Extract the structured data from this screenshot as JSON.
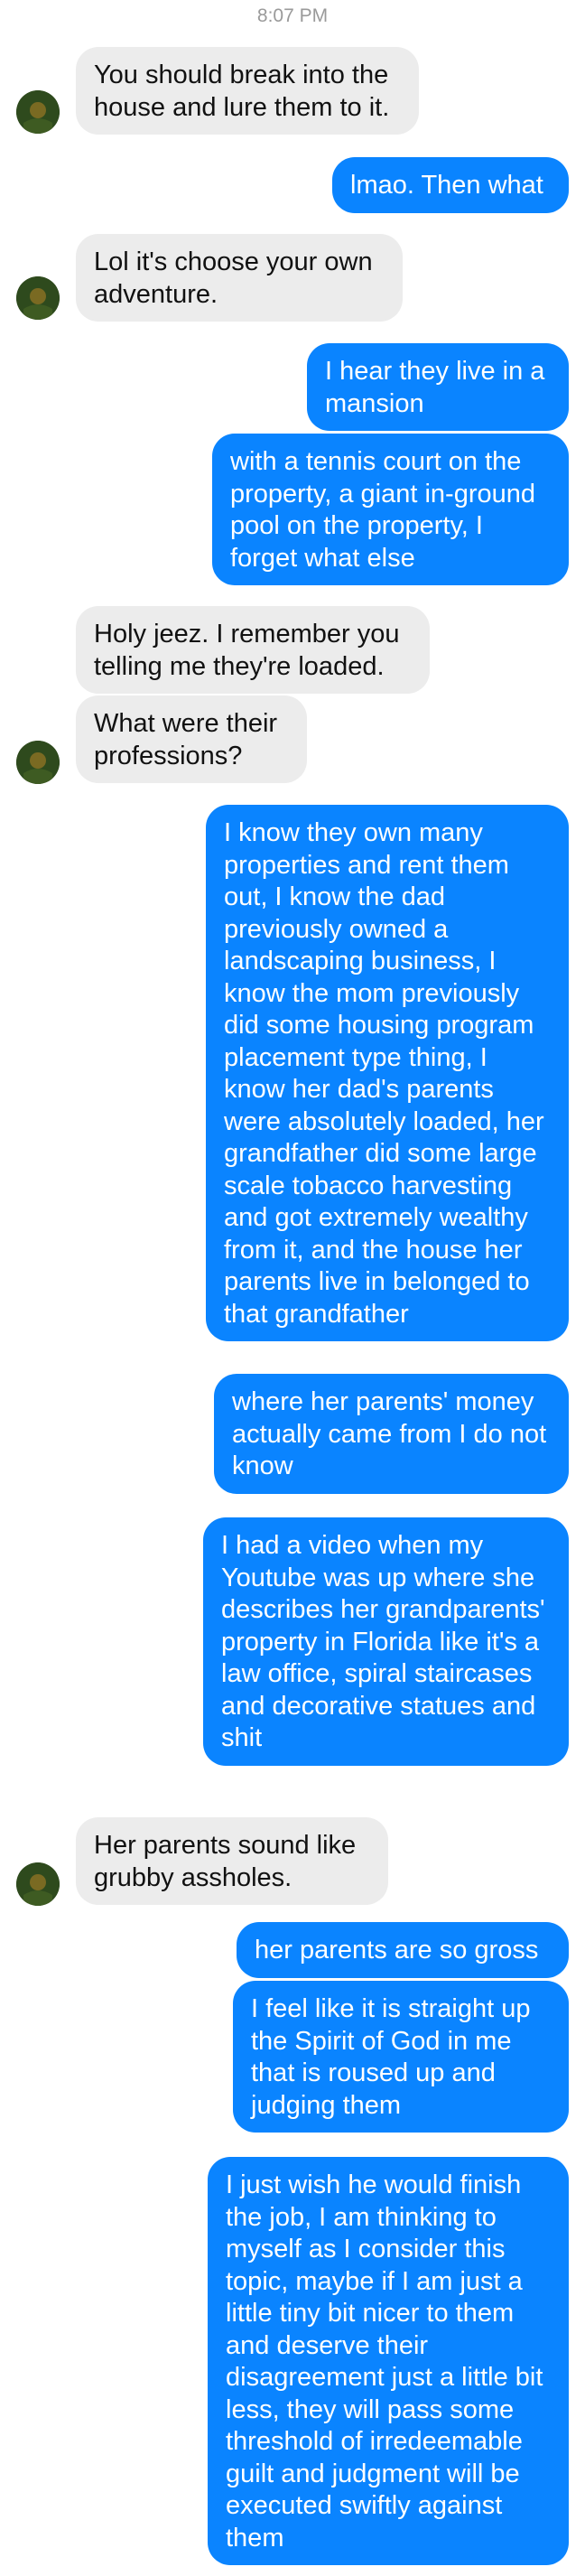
{
  "header": {
    "timestamp": "8:07 PM"
  },
  "messages": [
    {
      "direction": "in",
      "text": "You should break into the house and lure them to it."
    },
    {
      "direction": "out",
      "text": "lmao. Then what"
    },
    {
      "direction": "in",
      "text": "Lol it's choose your own adventure."
    },
    {
      "direction": "out",
      "text": "I hear they live in a mansion"
    },
    {
      "direction": "out",
      "text": "with a tennis court on the property, a giant in-ground pool on the property, I forget what else"
    },
    {
      "direction": "in",
      "text": "Holy jeez. I remember you telling me they're loaded."
    },
    {
      "direction": "in",
      "text": "What were their professions?"
    },
    {
      "direction": "out",
      "text": "I know they own many properties and rent them out, I know the dad previously owned a landscaping business, I know the mom previously did some housing program placement type thing, I know her dad's parents were absolutely loaded, her grandfather did some large scale tobacco harvesting and got extremely wealthy from it, and the house her parents live in belonged to that grandfather"
    },
    {
      "direction": "out",
      "text": "where her parents' money actually came from I do not know"
    },
    {
      "direction": "out",
      "text": "I had a video when my Youtube was up where she describes her grandparents' property in Florida like it's a law office, spiral staircases and decorative statues and shit"
    },
    {
      "direction": "in",
      "text": "Her parents sound like grubby assholes."
    },
    {
      "direction": "out",
      "text": "her parents are so gross"
    },
    {
      "direction": "out",
      "text": "I feel like it is straight up the Spirit of God in me that is roused up and judging them"
    },
    {
      "direction": "out",
      "text": "I just wish he would finish the job, I am thinking to myself as I consider this topic, maybe if I am just a little tiny bit nicer to them and deserve their disagreement just a little bit less, they will pass some threshold of irredeemable guilt and judgment will be executed swiftly against them"
    }
  ],
  "icons": {
    "contact_avatar": "contact-avatar-icon"
  }
}
